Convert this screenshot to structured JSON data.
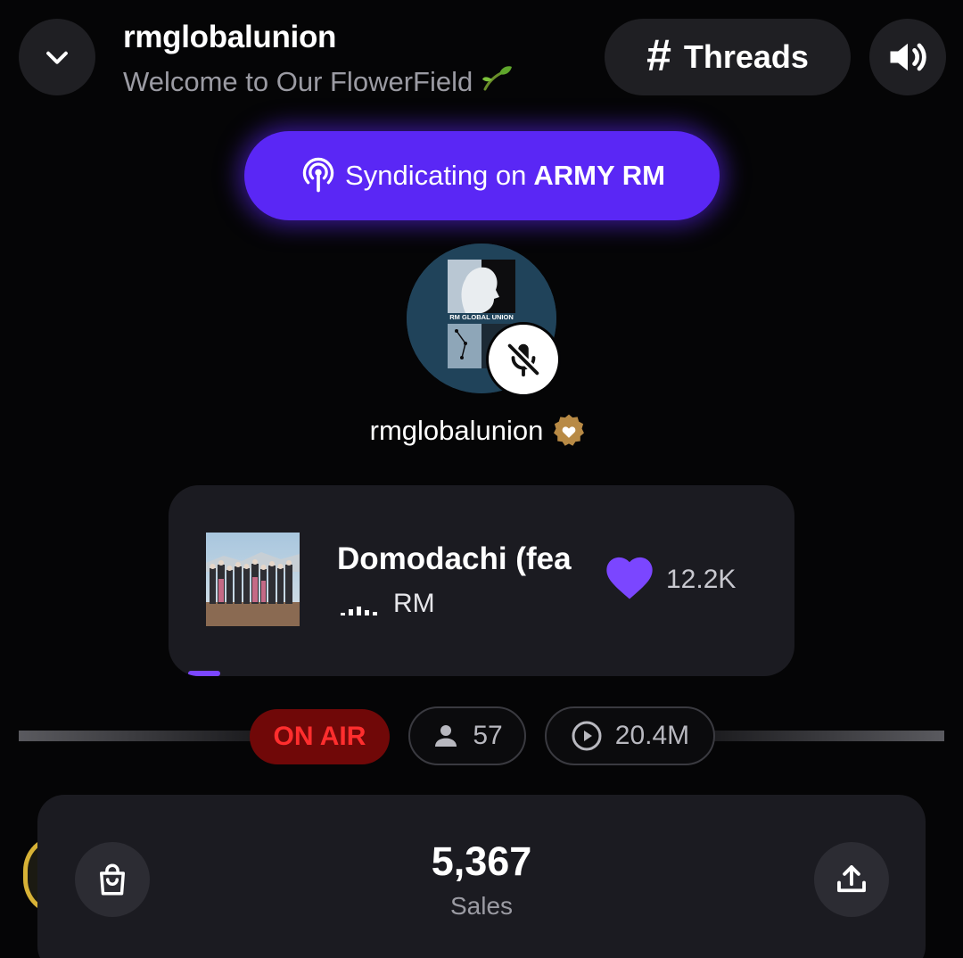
{
  "header": {
    "title": "rmglobalunion",
    "subtitle": "Welcome to Our FlowerField",
    "subtitle_icon": "sprout-emoji",
    "threads_hash": "#",
    "threads_label": "Threads"
  },
  "syndicate": {
    "prefix": "Syndicating on",
    "channel": "ARMY RM",
    "icon": "podcast-icon",
    "color": "#5a27f5"
  },
  "profile": {
    "avatar_text": "RM GLOBAL UNION",
    "name": "rmglobalunion",
    "verified_icon": "heart-seal-badge",
    "mic_state": "muted"
  },
  "now_playing": {
    "title": "Domodachi (fea",
    "artist": "RM",
    "likes": "12.2K",
    "like_color": "#7b46ff",
    "progress_fraction": 0.05
  },
  "stats": {
    "on_air": "ON AIR",
    "listeners": "57",
    "plays": "20.4M"
  },
  "sales": {
    "value": "5,367",
    "label": "Sales"
  }
}
